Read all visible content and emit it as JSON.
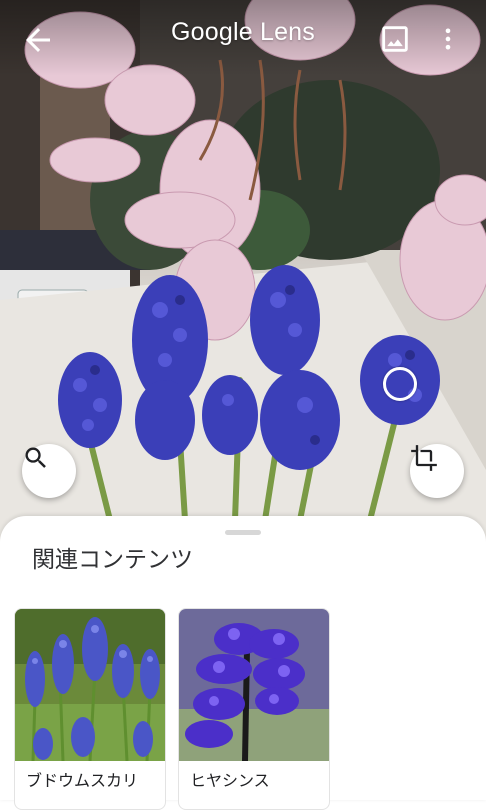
{
  "app": {
    "title": "Google Lens"
  },
  "toolbar": {
    "back_icon": "arrow-back-icon",
    "gallery_icon": "image-gallery-icon",
    "more_icon": "more-vert-icon"
  },
  "viewfinder": {
    "search_icon": "search-icon",
    "crop_icon": "crop-icon"
  },
  "results": {
    "heading": "関連コンテンツ",
    "items": [
      {
        "label": "ブドウムスカリ",
        "thumb": "grape-hyacinth-photo"
      },
      {
        "label": "ヒヤシンス",
        "thumb": "hyacinth-photo"
      }
    ]
  },
  "colors": {
    "accent_blue": "#3b3fb8",
    "sheet_bg": "#ffffff",
    "text_primary": "#303134"
  }
}
